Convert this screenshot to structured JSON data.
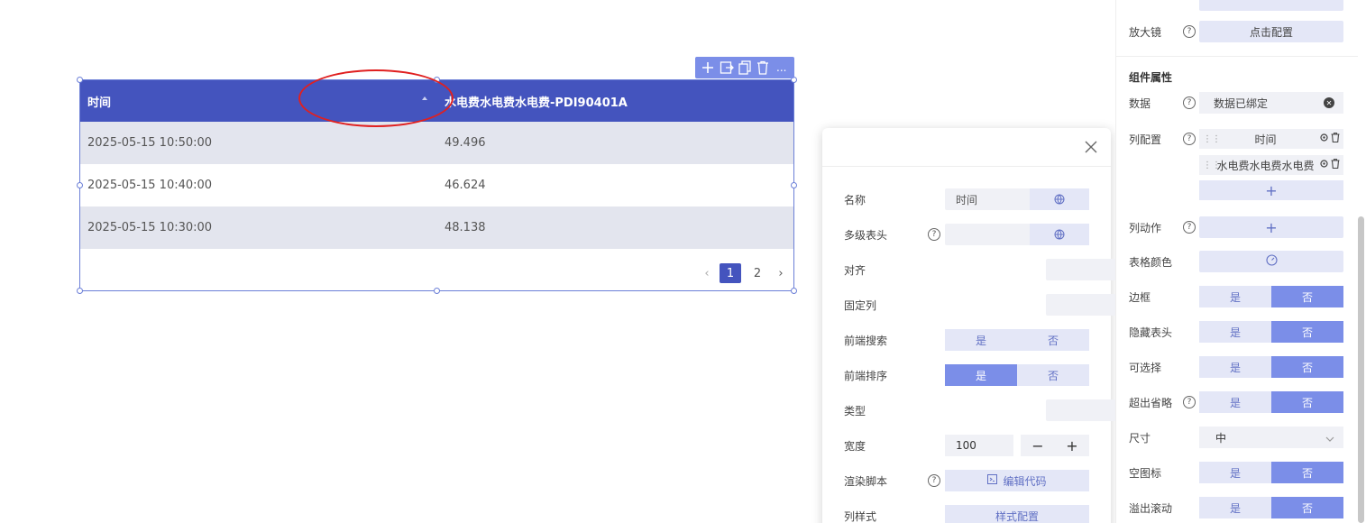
{
  "table": {
    "columns": [
      "时间",
      "水电费水电费水电费-PDI90401A"
    ],
    "rows": [
      [
        "2025-05-15 10:50:00",
        "49.496"
      ],
      [
        "2025-05-15 10:40:00",
        "46.624"
      ],
      [
        "2025-05-15 10:30:00",
        "48.138"
      ]
    ],
    "pagination": {
      "pages": [
        "1",
        "2"
      ],
      "current": "1"
    }
  },
  "widget_toolbar": {
    "more_label": "..."
  },
  "column_popup": {
    "name_label": "名称",
    "name_value": "时间",
    "multi_header_label": "多级表头",
    "align_label": "对齐",
    "fixed_label": "固定列",
    "front_search_label": "前端搜索",
    "front_sort_label": "前端排序",
    "type_label": "类型",
    "width_label": "宽度",
    "width_value": "100",
    "render_label": "渲染脚本",
    "edit_code": "编辑代码",
    "col_style_label": "列样式",
    "style_config": "样式配置",
    "yes": "是",
    "no": "否",
    "minus": "−",
    "plus": "+"
  },
  "props": {
    "magnifier_label": "放大镜",
    "click_config": "点击配置",
    "component_props_title": "组件属性",
    "data_label": "数据",
    "data_value": "数据已绑定",
    "col_config_label": "列配置",
    "col_items": [
      "时间",
      "水电费水电费水电费"
    ],
    "add": "+",
    "col_action_label": "列动作",
    "table_color_label": "表格颜色",
    "border_label": "边框",
    "hide_header_label": "隐藏表头",
    "selectable_label": "可选择",
    "ellipsis_label": "超出省略",
    "size_label": "尺寸",
    "size_value": "中",
    "empty_icon_label": "空图标",
    "overflow_scroll_label": "溢出滚动",
    "yes": "是",
    "no": "否"
  },
  "colors": {
    "header": "#4454be",
    "accent": "#7b8ee8",
    "annotation": "#e02020"
  }
}
